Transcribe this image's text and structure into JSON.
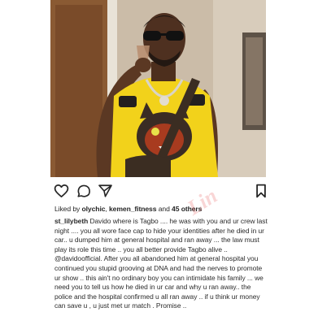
{
  "post": {
    "photo_alt": "photo",
    "icons": {
      "like": "heart-outline-icon",
      "comment": "comment-bubble-icon",
      "share": "paper-plane-icon",
      "save": "bookmark-icon"
    },
    "likes": {
      "prefix": "Liked by ",
      "user1": "olychic",
      "sep": ", ",
      "user2": "kemen_fitness",
      "and": " and ",
      "others": "45 others"
    },
    "caption": {
      "username": "st_lilybeth",
      "text": " Davido where is Tagbo .... he was with you and ur crew last night .... you all wore face cap to hide your identities after he died in ur car.. u dumped him at general hospital and ran away ... the law must play its role this time .. you all better provide Tagbo alive .. @davidoofficial. After you all abandoned him at general hospital you continued you stupid grooving at DNA and had the nerves to promote ur show .. this ain't no ordinary boy you can intimidate his family ... we need you to tell us how he died in ur car and why u ran away.. the police and the hospital confirmed u all ran away .. if u think ur money can save u , u just met ur match . Promise .."
    }
  },
  "colors": {
    "text": "#262626",
    "shirt": "#f2d21b",
    "watermark": "#dc1e1e"
  }
}
